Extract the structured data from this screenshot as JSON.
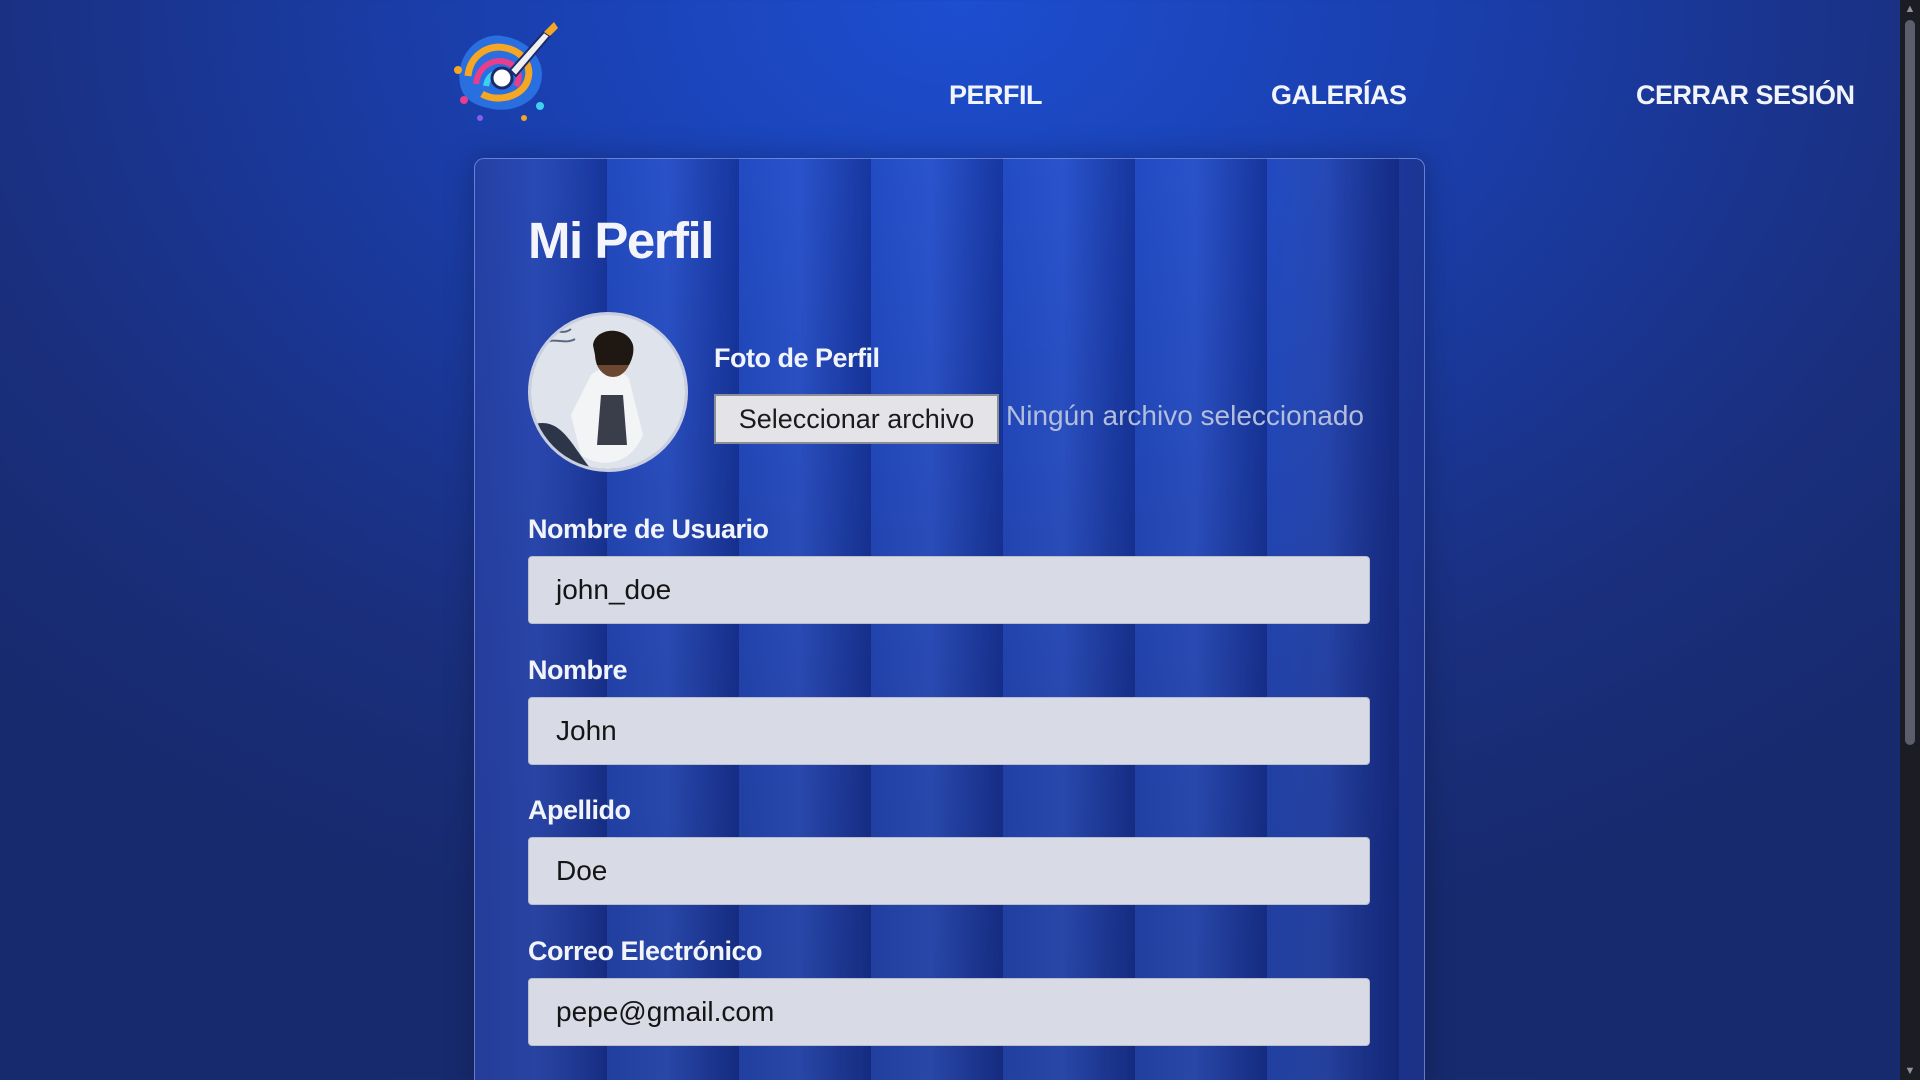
{
  "nav": {
    "logo": "palette-brush-logo",
    "perfil": "PERFIL",
    "galerias": "GALERÍAS",
    "cerrar_sesion": "CERRAR SESIÓN"
  },
  "profile": {
    "title": "Mi Perfil",
    "avatar": "album-cover-avatar",
    "photo_label": "Foto de Perfil",
    "file_button": "Seleccionar archivo",
    "file_status": "Ningún archivo seleccionado"
  },
  "fields": {
    "username": {
      "label": "Nombre de Usuario",
      "value": "john_doe"
    },
    "first_name": {
      "label": "Nombre",
      "value": "John"
    },
    "last_name": {
      "label": "Apellido",
      "value": "Doe"
    },
    "email": {
      "label": "Correo Electrónico",
      "value": "pepe@gmail.com"
    }
  },
  "colors": {
    "background": "#1a3fae",
    "input_bg": "#d8dae6",
    "text": "#f2f4fb"
  }
}
